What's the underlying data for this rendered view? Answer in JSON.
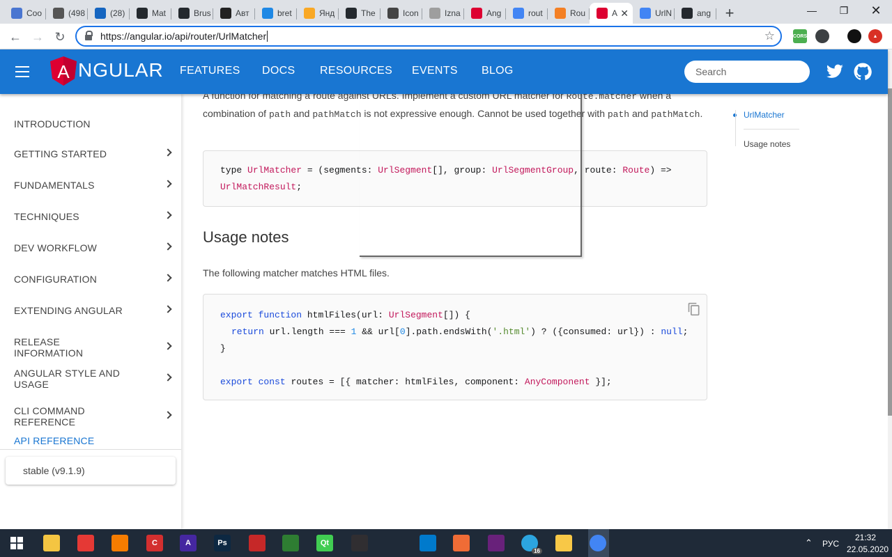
{
  "browser": {
    "tabs": [
      {
        "title": "Coo",
        "color": "#4a76d1"
      },
      {
        "title": "(498",
        "color": "#555555"
      },
      {
        "title": "(28)",
        "color": "#1565c0"
      },
      {
        "title": "Mat",
        "color": "#24292e"
      },
      {
        "title": "Brus",
        "color": "#24292e"
      },
      {
        "title": "Авт",
        "color": "#222222"
      },
      {
        "title": "bret",
        "color": "#1e88e5"
      },
      {
        "title": "Янд",
        "color": "#f9a825"
      },
      {
        "title": "The",
        "color": "#24292e"
      },
      {
        "title": "Icon",
        "color": "#444444"
      },
      {
        "title": "Izna",
        "color": "#9e9e9e"
      },
      {
        "title": "Ang",
        "color": "#dd0031"
      },
      {
        "title": "rout",
        "color": "#4285f4"
      },
      {
        "title": "Rou",
        "color": "#f48024"
      },
      {
        "title": "A",
        "color": "#dd0031"
      },
      {
        "title": "UrlN",
        "color": "#4285f4"
      },
      {
        "title": "ang",
        "color": "#24292e"
      }
    ],
    "url": "https://angular.io/api/router/UrlMatcher"
  },
  "header": {
    "brand": "NGULAR",
    "brand_initial": "A",
    "nav": [
      "FEATURES",
      "DOCS",
      "RESOURCES",
      "EVENTS",
      "BLOG"
    ],
    "search_placeholder": "Search"
  },
  "sidebar": {
    "items": [
      {
        "label": "INTRODUCTION",
        "chevron": false
      },
      {
        "label": "GETTING STARTED",
        "chevron": true
      },
      {
        "label": "FUNDAMENTALS",
        "chevron": true
      },
      {
        "label": "TECHNIQUES",
        "chevron": true
      },
      {
        "label": "DEV WORKFLOW",
        "chevron": true
      },
      {
        "label": "CONFIGURATION",
        "chevron": true
      },
      {
        "label": "EXTENDING ANGULAR",
        "chevron": true
      },
      {
        "label": "RELEASE INFORMATION",
        "chevron": true
      },
      {
        "label": "ANGULAR STYLE AND USAGE",
        "chevron": true
      },
      {
        "label": "CLI COMMAND REFERENCE",
        "chevron": true
      },
      {
        "label": "API REFERENCE",
        "chevron": false
      }
    ],
    "version": "stable (v9.1.9)"
  },
  "content": {
    "intro": {
      "t1": "A function for matching a route against URLs. Implement a custom URL matcher for ",
      "c1": "Route.matcher",
      "t2": " when a combination of ",
      "c2": "path",
      "t3": " and ",
      "c3": "pathMatch",
      "t4": " is not expressive enough. Cannot be used together with ",
      "c4": "path",
      "t5": " and ",
      "c5": "pathMatch",
      "t6": "."
    },
    "signature": {
      "a": "type ",
      "b": "UrlMatcher",
      "c": " = (segments: ",
      "d": "UrlSegment",
      "e": "[], group: ",
      "f": "UrlSegmentGroup",
      "g": ", route: ",
      "h": "Route",
      "i": ") =>",
      "j": "UrlMatchResult",
      "k": ";"
    },
    "usage_heading": "Usage notes",
    "usage_text": "The following matcher matches HTML files.",
    "example": {
      "l1a": "export",
      "l1b": " ",
      "l1c": "function",
      "l1d": " htmlFiles(url: ",
      "l1e": "UrlSegment",
      "l1f": "[]) {",
      "l2a": "return",
      "l2b": " url.length === ",
      "l2c": "1",
      "l2d": " && url[",
      "l2e": "0",
      "l2f": "].path.endsWith(",
      "l2g": "'.html'",
      "l2h": ") ? ({consumed: url}) : ",
      "l2i": "null",
      "l2j": ";",
      "l3": "}",
      "l4a": "export",
      "l4b": " ",
      "l4c": "const",
      "l4d": " routes = [{ matcher: htmlFiles, component: ",
      "l4e": "AnyComponent",
      "l4f": " }];"
    }
  },
  "toc": [
    "UrlMatcher",
    "Usage notes"
  ],
  "taskbar": {
    "lang": "РУС",
    "time": "21:32",
    "date": "22.05.2020",
    "telegram_badge": "16",
    "icons": [
      {
        "name": "windows-start-icon",
        "color": "#1f2a38",
        "glyph": ""
      },
      {
        "name": "keepass-icon",
        "color": "#f4c542",
        "glyph": ""
      },
      {
        "name": "teamviewer-icon",
        "color": "#e53935",
        "glyph": ""
      },
      {
        "name": "color-picker-icon",
        "color": "#f57c00",
        "glyph": ""
      },
      {
        "name": "ccleaner-icon",
        "color": "#d32f2f",
        "glyph": "C"
      },
      {
        "name": "hex-editor-icon",
        "color": "#4527a0",
        "glyph": "A"
      },
      {
        "name": "photoshop-icon",
        "color": "#0d2842",
        "glyph": "Ps"
      },
      {
        "name": "filezilla-icon",
        "color": "#c62828",
        "glyph": ""
      },
      {
        "name": "fork-icon",
        "color": "#2e7d32",
        "glyph": ""
      },
      {
        "name": "qt-creator-icon",
        "color": "#41cd52",
        "glyph": "Qt"
      },
      {
        "name": "obs-icon",
        "color": "#302e31",
        "glyph": ""
      },
      {
        "name": "unity-icon",
        "color": "#1f2a38",
        "glyph": ""
      },
      {
        "name": "vscode-icon",
        "color": "#007acc",
        "glyph": ""
      },
      {
        "name": "postman-icon",
        "color": "#ef6c36",
        "glyph": ""
      },
      {
        "name": "visual-studio-icon",
        "color": "#68217a",
        "glyph": ""
      },
      {
        "name": "telegram-icon",
        "color": "#2ca5e0",
        "glyph": ""
      },
      {
        "name": "file-explorer-icon",
        "color": "#f8c847",
        "glyph": ""
      },
      {
        "name": "chrome-icon",
        "color": "#4285f4",
        "glyph": ""
      }
    ]
  }
}
